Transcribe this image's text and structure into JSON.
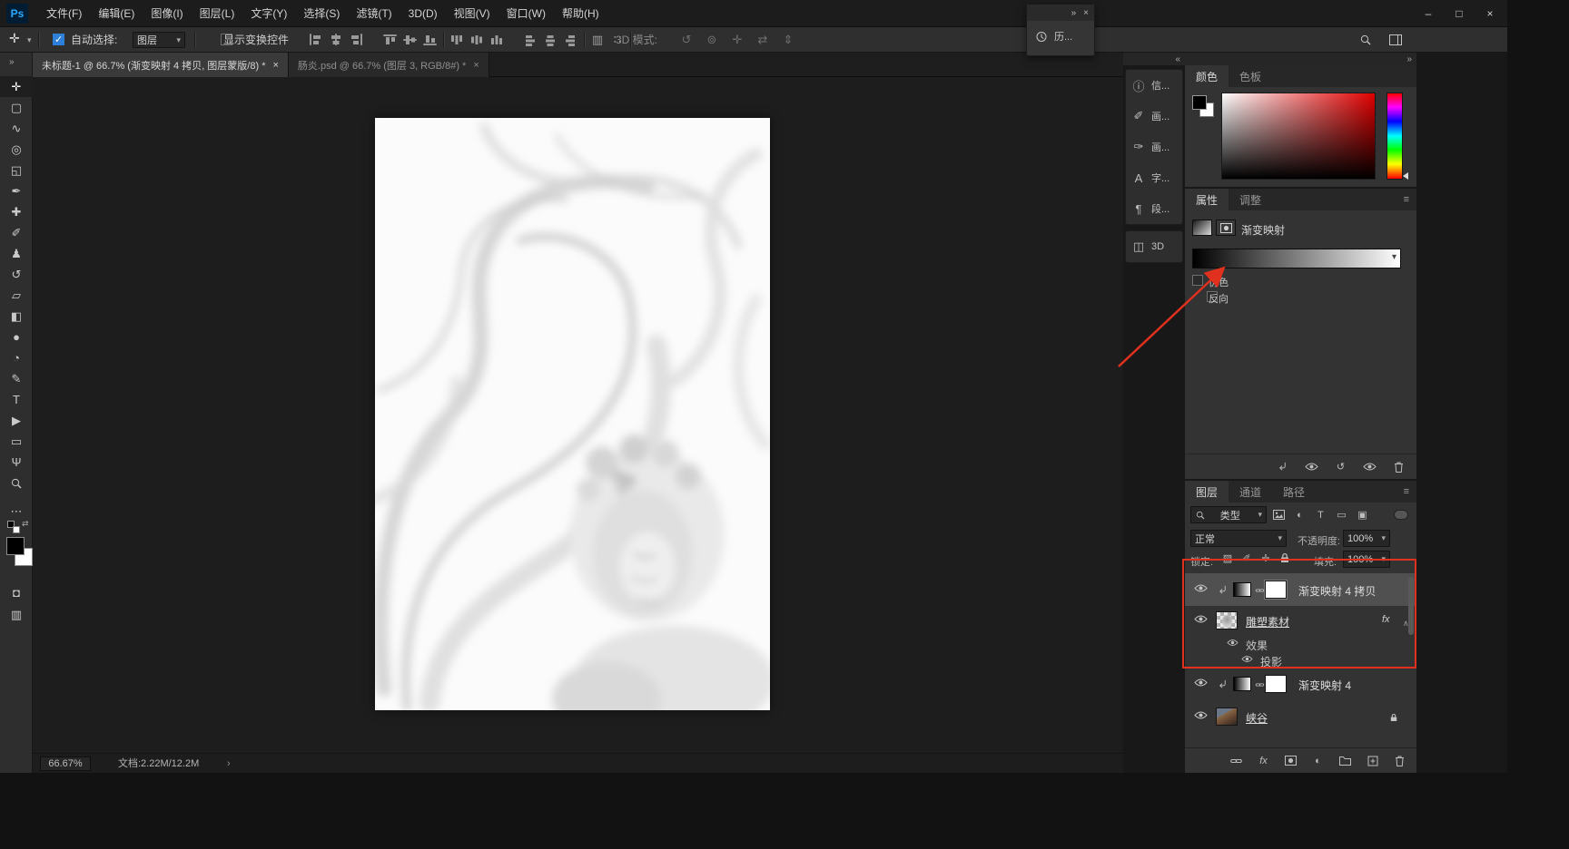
{
  "colors": {
    "annotation": "#e0301e",
    "accent": "#2d7fd9",
    "foreground": "#000000",
    "background": "#ffffff"
  },
  "titlebar": {
    "logo": "Ps",
    "menus": [
      {
        "label": "文件(F)"
      },
      {
        "label": "编辑(E)"
      },
      {
        "label": "图像(I)"
      },
      {
        "label": "图层(L)"
      },
      {
        "label": "文字(Y)"
      },
      {
        "label": "选择(S)"
      },
      {
        "label": "滤镜(T)"
      },
      {
        "label": "3D(D)"
      },
      {
        "label": "视图(V)"
      },
      {
        "label": "窗口(W)"
      },
      {
        "label": "帮助(H)"
      }
    ],
    "window_controls": [
      {
        "name": "minimize-button",
        "glyph": "–"
      },
      {
        "name": "maximize-button",
        "glyph": "□"
      },
      {
        "name": "close-button",
        "glyph": "×"
      }
    ]
  },
  "options_bar": {
    "active_tool_glyph": "✛",
    "auto_select_label": "自动选择:",
    "auto_select_target": "图层",
    "show_transform_label": "显示变换控件",
    "mode_3d_label": "3D 模式:",
    "mode_3d_icons": [
      {
        "name": "3d-orbit-icon",
        "glyph": "↺"
      },
      {
        "name": "3d-roll-icon",
        "glyph": "⊚"
      },
      {
        "name": "3d-pan-icon",
        "glyph": "✛"
      },
      {
        "name": "3d-slide-icon",
        "glyph": "⇄"
      },
      {
        "name": "3d-scale-icon",
        "glyph": "⇕"
      }
    ],
    "align_icons": [
      {
        "name": "align-left-icon"
      },
      {
        "name": "align-center-h-icon"
      },
      {
        "name": "align-right-icon"
      },
      {
        "name": "align-top-icon"
      },
      {
        "name": "align-middle-icon"
      },
      {
        "name": "align-bottom-icon"
      },
      {
        "name": "distribute-top-icon"
      },
      {
        "name": "distribute-middle-icon"
      },
      {
        "name": "distribute-bottom-icon"
      },
      {
        "name": "distribute-left-icon"
      },
      {
        "name": "distribute-center-v-icon"
      },
      {
        "name": "distribute-right-icon"
      },
      {
        "name": "distribute-spacing-h-icon",
        "glyph": "▥"
      },
      {
        "name": "distribute-spacing-v-icon",
        "glyph": "∷"
      }
    ]
  },
  "history_flyout": {
    "dock_glyph": "»",
    "close_glyph": "×",
    "label": "历..."
  },
  "document_tabs": [
    {
      "label": "未标题-1 @ 66.7% (渐变映射 4 拷贝, 图层蒙版/8) *",
      "close": "×",
      "active": true
    },
    {
      "label": "肠炎.psd @ 66.7% (图层 3, RGB/8#) *",
      "close": "×",
      "active": false
    }
  ],
  "toolbar": {
    "collapse_glyph": "»",
    "more_glyph": "⋯",
    "quickmask_glyph": "◘",
    "screenmode_glyph": "▥",
    "swap_glyph": "⇄",
    "tools": [
      {
        "name": "move-tool",
        "glyph": "✛",
        "active": true
      },
      {
        "name": "marquee-tool",
        "glyph": "▢"
      },
      {
        "name": "lasso-tool",
        "glyph": "∿"
      },
      {
        "name": "quick-selection-tool",
        "glyph": "◎"
      },
      {
        "name": "crop-tool",
        "glyph": "◱"
      },
      {
        "name": "eyedropper-tool",
        "glyph": "✒"
      },
      {
        "name": "healing-brush-tool",
        "glyph": "✚"
      },
      {
        "name": "brush-tool",
        "glyph": "✐"
      },
      {
        "name": "clone-stamp-tool",
        "glyph": "♟"
      },
      {
        "name": "history-brush-tool",
        "glyph": "↺"
      },
      {
        "name": "eraser-tool",
        "glyph": "▱"
      },
      {
        "name": "gradient-tool",
        "glyph": "◧"
      },
      {
        "name": "blur-tool",
        "glyph": "●"
      },
      {
        "name": "dodge-tool",
        "glyph": "◔"
      },
      {
        "name": "pen-tool",
        "glyph": "✎"
      },
      {
        "name": "type-tool",
        "glyph": "T"
      },
      {
        "name": "path-selection-tool",
        "glyph": "▶"
      },
      {
        "name": "shape-tool",
        "glyph": "▭"
      },
      {
        "name": "hand-tool",
        "glyph": "Ψ"
      },
      {
        "name": "zoom-tool",
        "icon": "magnifier"
      }
    ]
  },
  "right_strip": {
    "collapse_glyph": "«",
    "items": [
      {
        "name": "info-panel",
        "glyph": "ⓘ",
        "label": "信..."
      },
      {
        "name": "brush-settings-panel",
        "glyph": "✐",
        "label": "画..."
      },
      {
        "name": "brushes-panel",
        "glyph": "✑",
        "label": "画..."
      },
      {
        "name": "character-panel",
        "glyph": "A",
        "label": "字..."
      },
      {
        "name": "paragraph-panel",
        "glyph": "¶",
        "label": "段..."
      },
      {
        "name": "3d-panel",
        "glyph": "◫",
        "label": "3D"
      }
    ]
  },
  "panels": {
    "dock_collapse_glyph": "»",
    "color": {
      "tabs": [
        "颜色",
        "色板"
      ]
    },
    "properties": {
      "tabs": [
        "属性",
        "调整"
      ],
      "title": "渐变映射",
      "dither_label": "仿色",
      "reverse_label": "反向",
      "footer_icons": [
        {
          "name": "clip-to-layer-icon",
          "icon": "clip"
        },
        {
          "name": "previous-state-icon",
          "icon": "eye"
        },
        {
          "name": "reset-icon",
          "glyph": "↺"
        },
        {
          "name": "visibility-icon",
          "icon": "eye"
        },
        {
          "name": "delete-icon",
          "icon": "trash"
        }
      ]
    },
    "layers": {
      "tabs": [
        "图层",
        "通道",
        "路径"
      ],
      "filter_label": "类型",
      "filter_icons": [
        {
          "name": "filter-pixel-layers-icon",
          "icon": "image"
        },
        {
          "name": "filter-adjustment-layers-icon",
          "glyph": "◐"
        },
        {
          "name": "filter-type-layers-icon",
          "glyph": "T"
        },
        {
          "name": "filter-shape-layers-icon",
          "glyph": "▭"
        },
        {
          "name": "filter-smart-objects-icon",
          "glyph": "▣"
        }
      ],
      "blend_mode": "正常",
      "opacity_label": "不透明度:",
      "opacity_value": "100%",
      "lock_label": "锁定:",
      "lock_icons": [
        {
          "name": "lock-transparent-icon",
          "glyph": "▨"
        },
        {
          "name": "lock-pixels-icon",
          "glyph": "✐"
        },
        {
          "name": "lock-position-icon",
          "glyph": "✛"
        },
        {
          "name": "lock-all-icon",
          "icon": "lock"
        }
      ],
      "fill_label": "填充:",
      "fill_value": "100%",
      "rows": [
        {
          "name": "渐变映射 4 拷贝"
        },
        {
          "name": "雕塑素材",
          "fx_badge": "fx"
        },
        {
          "name": "效果"
        },
        {
          "name": "投影"
        },
        {
          "name": "渐变映射 4"
        },
        {
          "name": "峡谷"
        }
      ],
      "footer_icons": [
        {
          "name": "link-layers-icon",
          "icon": "link"
        },
        {
          "name": "layer-style-icon",
          "glyph": "fx",
          "italic": true
        },
        {
          "name": "add-mask-icon",
          "icon": "mask"
        },
        {
          "name": "new-adjustment-layer-icon",
          "glyph": "◐"
        },
        {
          "name": "new-group-icon",
          "icon": "folder"
        },
        {
          "name": "new-layer-icon",
          "icon": "newlayer"
        },
        {
          "name": "delete-layer-icon",
          "icon": "trash"
        }
      ]
    }
  },
  "status_bar": {
    "zoom": "66.67%",
    "doc_info": "文档:2.22M/12.2M",
    "expander": "›"
  }
}
